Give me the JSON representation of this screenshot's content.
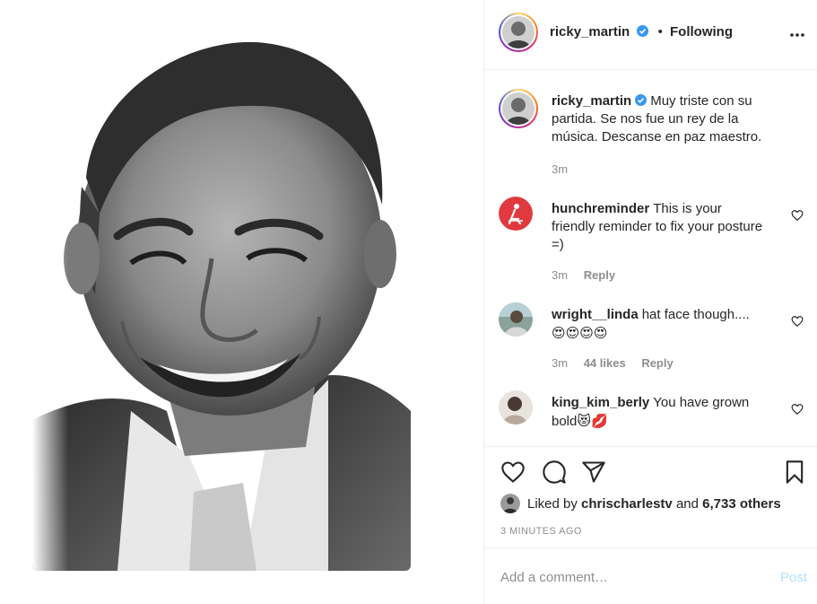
{
  "post": {
    "author": "ricky_martin",
    "follow_status": "Following",
    "caption": "Muy triste con su partida. Se nos fue un rey de la música. Descanse en paz maestro.",
    "caption_time": "3m"
  },
  "comments": [
    {
      "user": "hunchreminder",
      "text": "This is your friendly reminder to fix your posture =)",
      "time": "3m",
      "likes": "",
      "reply": "Reply"
    },
    {
      "user": "wright__linda",
      "text": "hat face though....",
      "emoji": "😍😍😍😍",
      "time": "3m",
      "likes": "44 likes",
      "reply": "Reply"
    },
    {
      "user": "king_kim_berly",
      "text": "You have grown bold",
      "emoji": "😻💋",
      "time": "",
      "likes": "",
      "reply": ""
    }
  ],
  "likes": {
    "prefix": "Liked by",
    "user": "chrischarlestv",
    "joiner": "and",
    "others": "6,733 others"
  },
  "timestamp": "3 MINUTES AGO",
  "add_comment": {
    "placeholder": "Add a comment…",
    "post_label": "Post"
  },
  "colors": {
    "verified": "#3897f0",
    "muted": "#8e8e8e",
    "post_disabled": "#b2dffc",
    "hunch_avatar": "#e0393e"
  },
  "icons": [
    "more-options-icon",
    "verified-icon",
    "heart-icon",
    "comment-icon",
    "share-icon",
    "bookmark-icon"
  ]
}
